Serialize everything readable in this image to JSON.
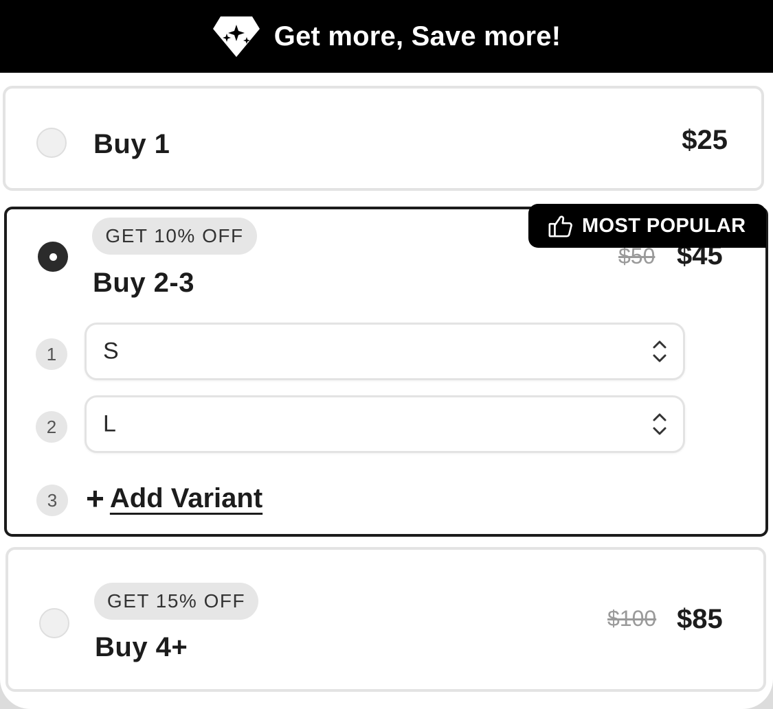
{
  "banner": {
    "text": "Get more, Save more!",
    "icon": "diamond-sparkle-icon"
  },
  "offers": [
    {
      "title": "Buy 1",
      "price": "$25"
    },
    {
      "title": "Buy 2-3",
      "discount": "GET 10% OFF",
      "badge": "MOST POPULAR",
      "old_price": "$50",
      "price": "$45",
      "variants": [
        {
          "number": "1",
          "value": "S"
        },
        {
          "number": "2",
          "value": "L"
        }
      ],
      "add": {
        "number": "3",
        "plus": "+",
        "label": "Add Variant"
      }
    },
    {
      "title": "Buy 4+",
      "discount": "GET 15% OFF",
      "old_price": "$100",
      "price": "$85"
    }
  ],
  "colors": {
    "banner_bg": "#000000",
    "selected_border": "#1b1b1b",
    "pill_bg": "#e6e6e6",
    "card_border": "#e3e3e3"
  }
}
